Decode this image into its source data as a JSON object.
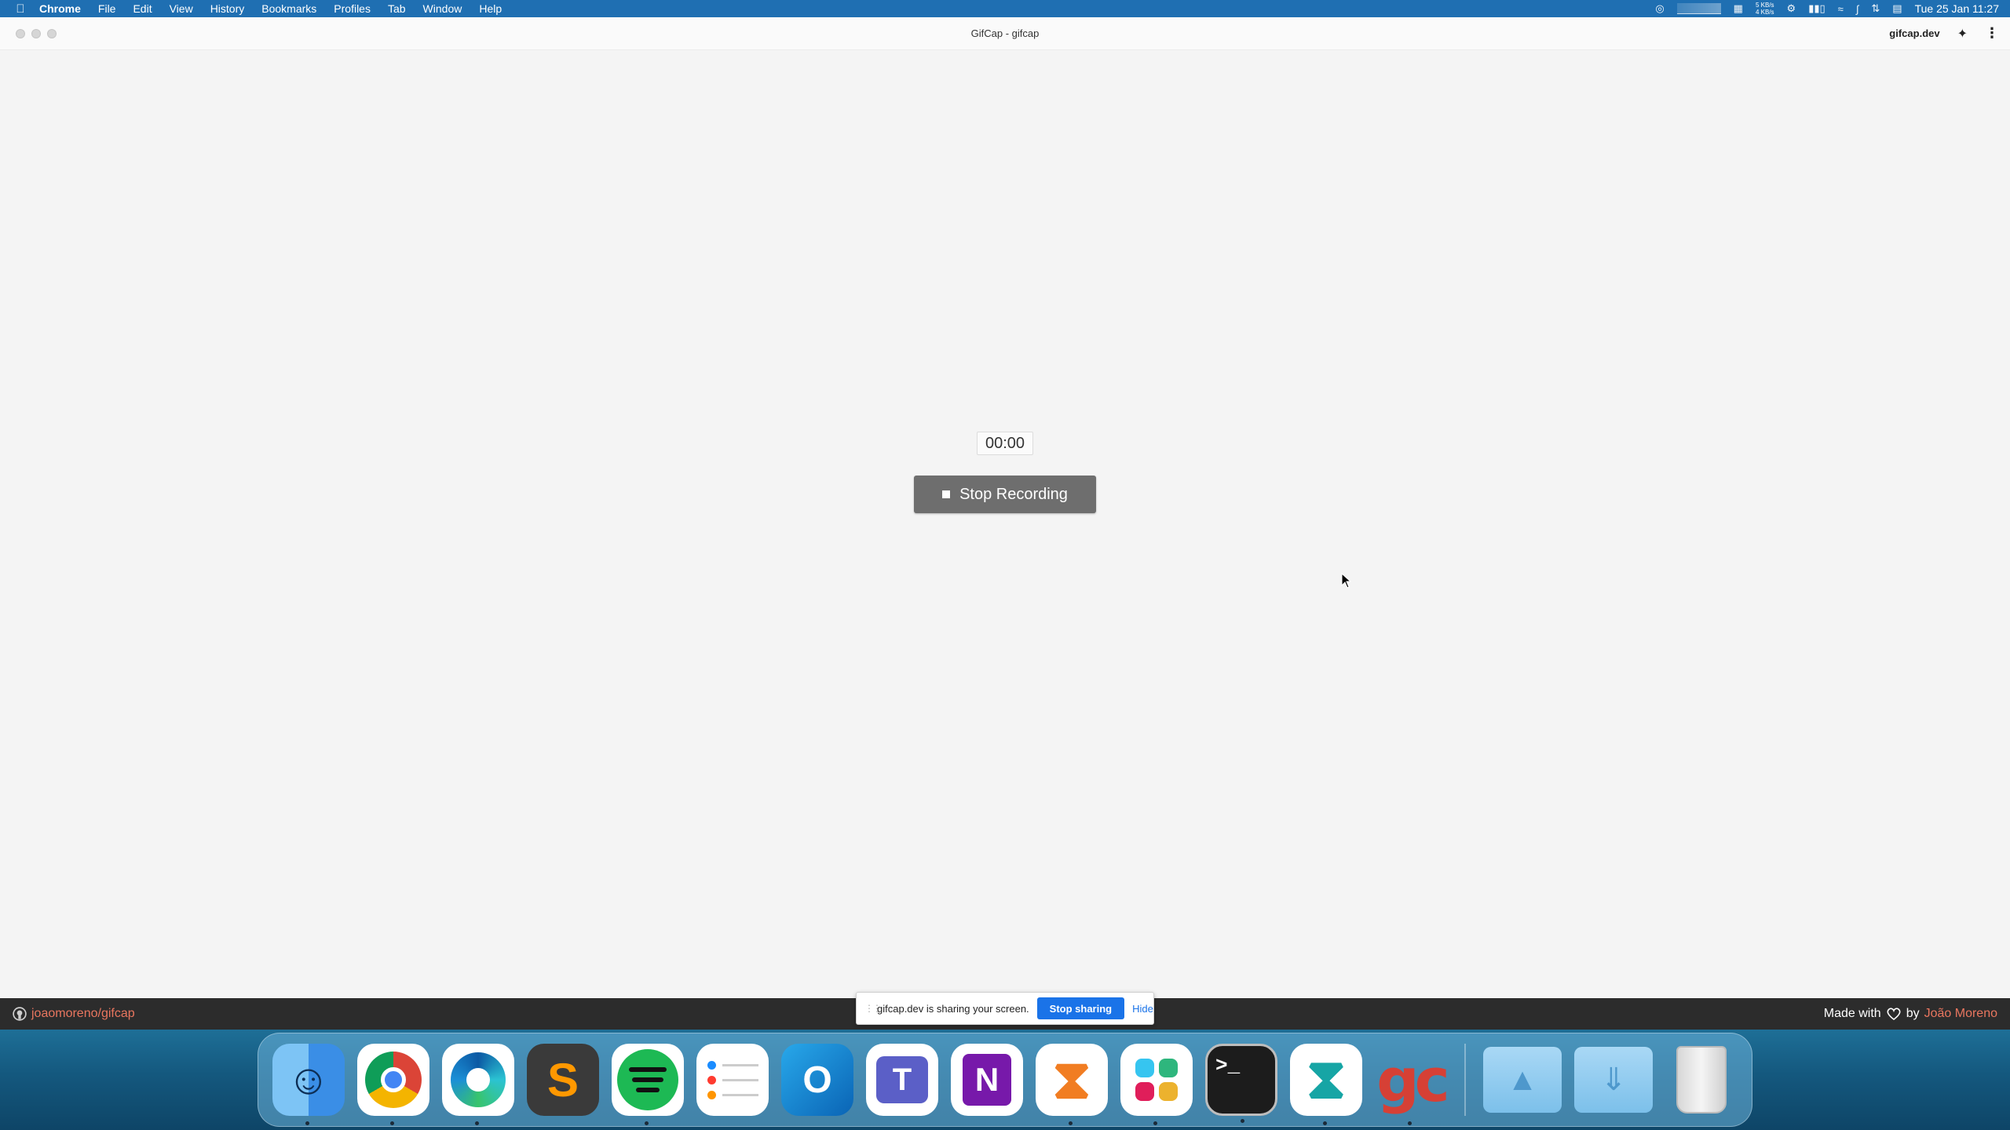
{
  "menubar": {
    "app_name": "Chrome",
    "items": [
      "File",
      "Edit",
      "View",
      "History",
      "Bookmarks",
      "Profiles",
      "Tab",
      "Window",
      "Help"
    ],
    "net_up": "5 KB/s",
    "net_down": "4 KB/s",
    "clock": "Tue 25 Jan  11:27"
  },
  "window": {
    "title": "GifCap - gifcap",
    "host": "gifcap.dev"
  },
  "recorder": {
    "timer": "00:00",
    "stop_label": "Stop Recording"
  },
  "footer": {
    "repo": "joaomoreno/gifcap",
    "made_with": "Made with",
    "by": "by",
    "author": "João Moreno"
  },
  "sharebar": {
    "message": "gifcap.dev is sharing your screen.",
    "stop_label": "Stop sharing",
    "hide_label": "Hide"
  },
  "dock": {
    "apps": [
      "Finder",
      "Google Chrome",
      "Microsoft Edge",
      "Sublime Text",
      "Spotify",
      "Reminders",
      "Microsoft Outlook",
      "Microsoft Teams",
      "Microsoft OneNote",
      "Visual Studio",
      "Slack",
      "Terminal",
      "Visual Studio Code",
      "GifCap",
      "Applications",
      "Downloads",
      "Trash"
    ],
    "running": [
      0,
      1,
      2,
      4,
      9,
      10,
      11,
      12,
      13
    ],
    "colors": {
      "footer_link": "#e9765f",
      "share_button": "#1a73e8",
      "menubar": "#1f6fb2"
    }
  }
}
